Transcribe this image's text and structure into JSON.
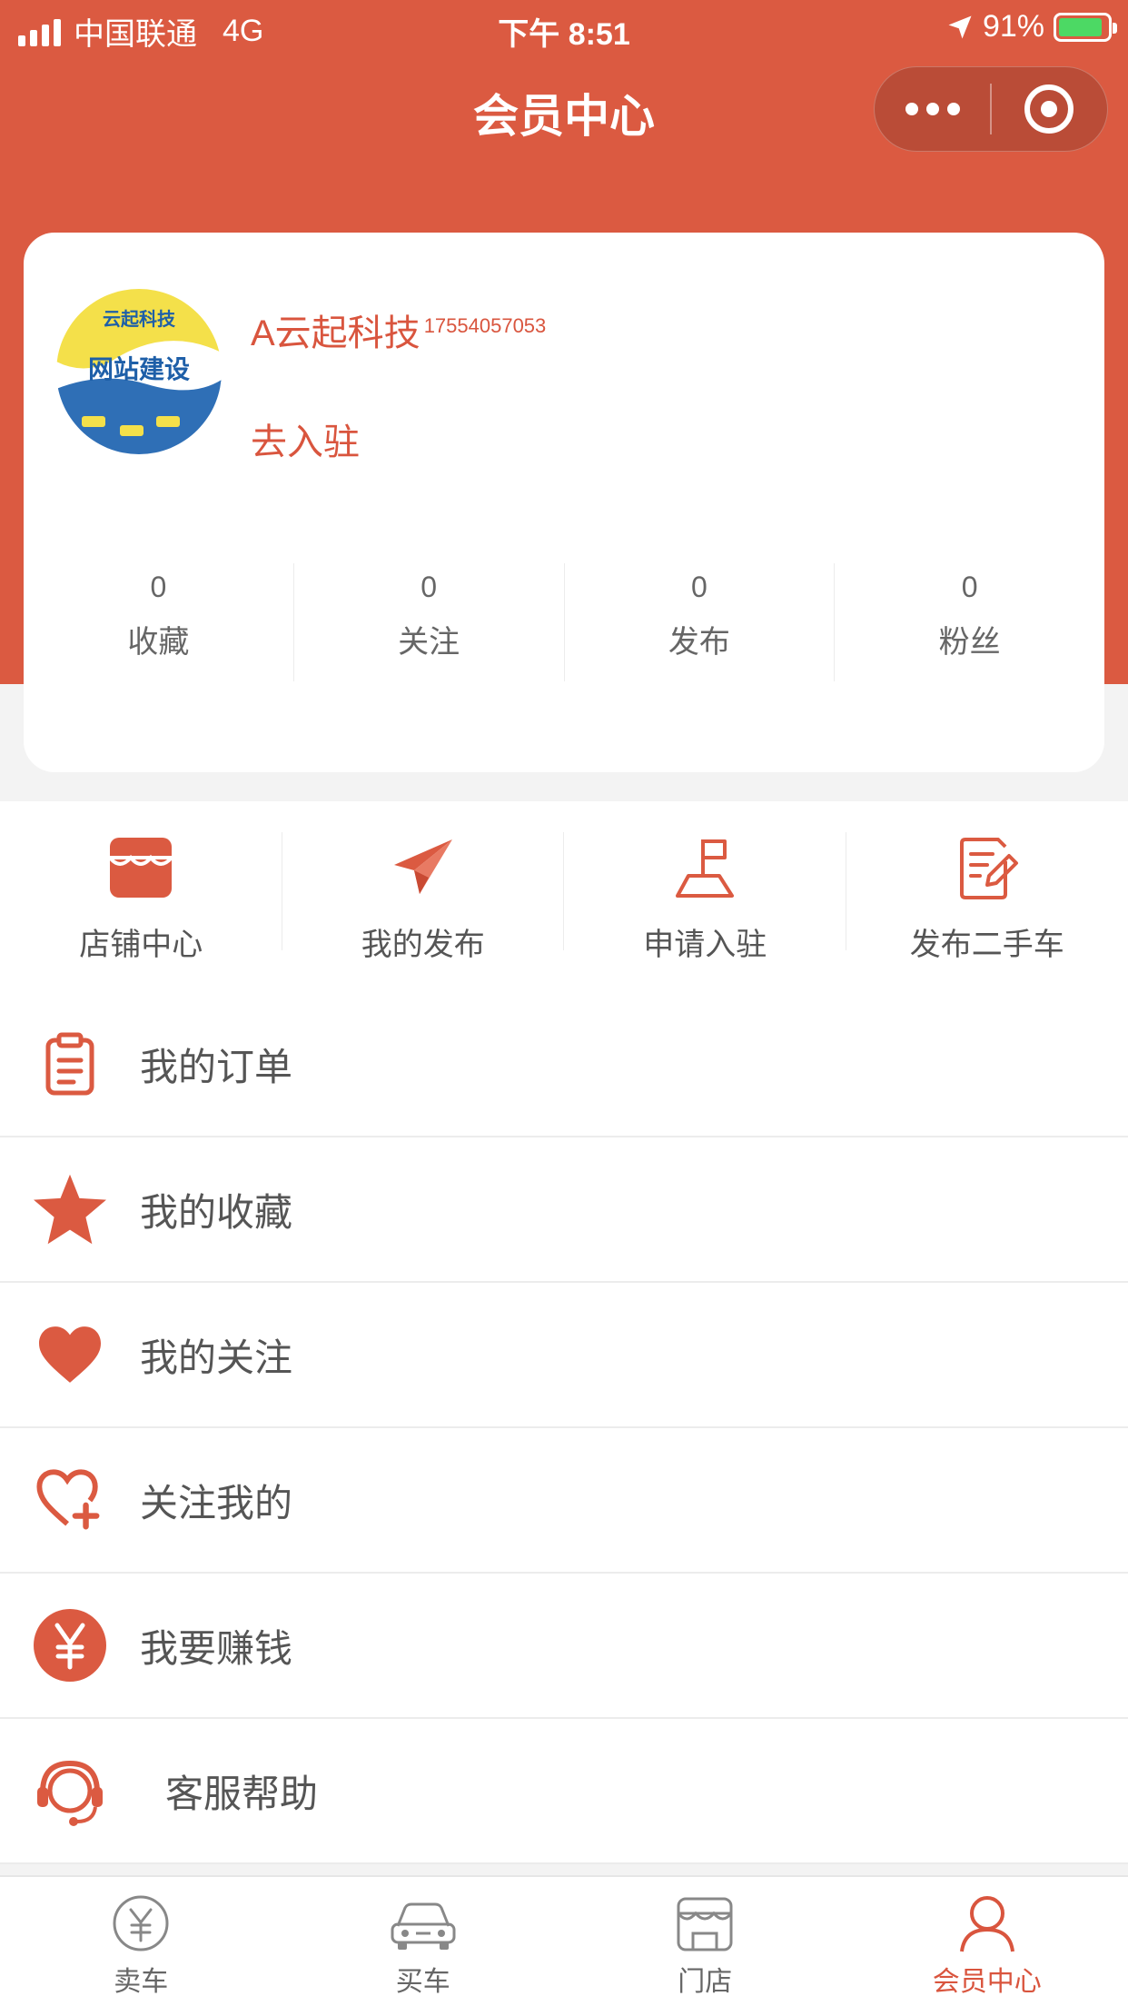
{
  "status_bar": {
    "carrier": "中国联通",
    "network": "4G",
    "time": "下午 8:51",
    "battery": "91%",
    "battery_level": 0.91
  },
  "nav": {
    "title": "会员中心"
  },
  "profile": {
    "name": "A云起科技",
    "phone": "17554057053",
    "settle_link": "去入驻"
  },
  "stats": [
    {
      "value": "0",
      "label": "收藏"
    },
    {
      "value": "0",
      "label": "关注"
    },
    {
      "value": "0",
      "label": "发布"
    },
    {
      "value": "0",
      "label": "粉丝"
    }
  ],
  "quick_actions": [
    {
      "label": "店铺中心",
      "icon": "store-icon"
    },
    {
      "label": "我的发布",
      "icon": "paper-plane-icon"
    },
    {
      "label": "申请入驻",
      "icon": "flag-icon"
    },
    {
      "label": "发布二手车",
      "icon": "edit-document-icon"
    }
  ],
  "menu": [
    {
      "label": "我的订单",
      "icon": "clipboard-icon"
    },
    {
      "label": "我的收藏",
      "icon": "star-icon"
    },
    {
      "label": "我的关注",
      "icon": "heart-icon"
    },
    {
      "label": "关注我的",
      "icon": "heart-plus-icon"
    },
    {
      "label": "我要赚钱",
      "icon": "yuan-icon"
    },
    {
      "label": "客服帮助",
      "icon": "headset-icon"
    }
  ],
  "tabbar": [
    {
      "label": "卖车",
      "icon": "yuan-circle-icon",
      "active": false
    },
    {
      "label": "买车",
      "icon": "car-icon",
      "active": false
    },
    {
      "label": "门店",
      "icon": "shop-icon",
      "active": false
    },
    {
      "label": "会员中心",
      "icon": "user-icon",
      "active": true
    }
  ],
  "colors": {
    "accent": "#db5a41",
    "text": "#555555",
    "background": "#f3f3f3"
  }
}
